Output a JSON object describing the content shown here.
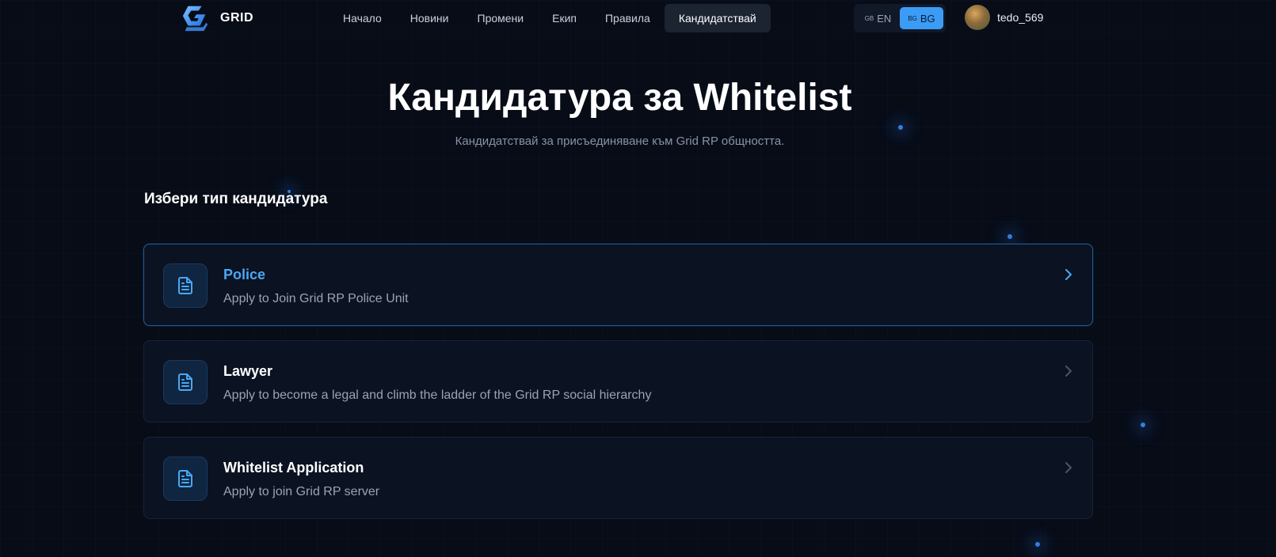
{
  "brand": {
    "name": "GRID"
  },
  "nav": {
    "items": [
      {
        "label": "Начало"
      },
      {
        "label": "Новини"
      },
      {
        "label": "Промени"
      },
      {
        "label": "Екип"
      },
      {
        "label": "Правила"
      },
      {
        "label": "Кандидатствай",
        "active": true
      }
    ]
  },
  "lang": {
    "options": [
      {
        "code": "GB",
        "label": "EN",
        "active": false
      },
      {
        "code": "BG",
        "label": "BG",
        "active": true
      }
    ]
  },
  "user": {
    "username": "tedo_569"
  },
  "hero": {
    "title": "Кандидатура за Whitelist",
    "subtitle": "Кандидатствай за присъединяване към Grid RP общността."
  },
  "section": {
    "title": "Избери тип кандидатура"
  },
  "applications": [
    {
      "title": "Police",
      "description": "Apply to Join Grid RP Police Unit",
      "icon": "document-icon",
      "highlighted": true
    },
    {
      "title": "Lawyer",
      "description": "Apply to become a legal and climb the ladder of the Grid RP social hierarchy",
      "icon": "document-icon",
      "highlighted": false
    },
    {
      "title": "Whitelist Application",
      "description": "Apply to join Grid RP server",
      "icon": "document-icon",
      "highlighted": false
    }
  ],
  "colors": {
    "background": "#070c17",
    "accent": "#3b9cf5",
    "highlight_title": "#4aa8f5",
    "card_bg": "#0b1222"
  }
}
